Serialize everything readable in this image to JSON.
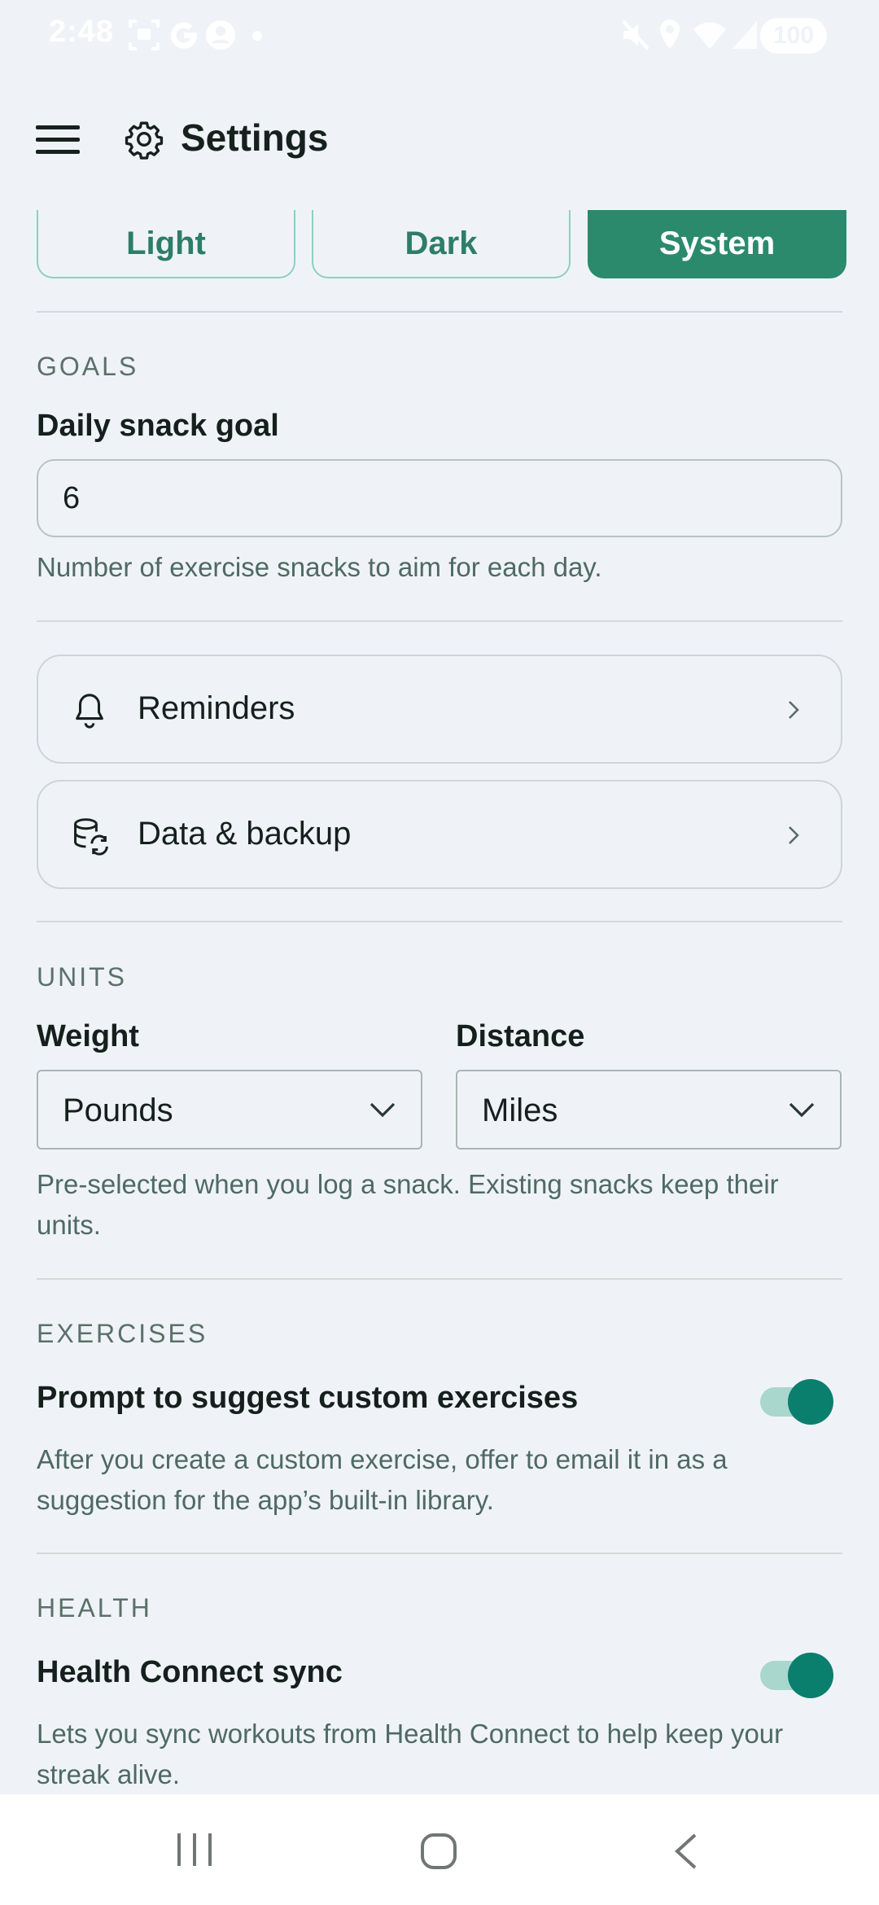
{
  "status_bar": {
    "time": "2:48",
    "battery": "100"
  },
  "app_bar": {
    "title": "Settings"
  },
  "theme": {
    "options": [
      "Light",
      "Dark",
      "System"
    ],
    "selected": "System"
  },
  "goals": {
    "section_label": "GOALS",
    "field_label": "Daily snack goal",
    "value": "6",
    "helper": "Number of exercise snacks to aim for each day."
  },
  "links": {
    "reminders": "Reminders",
    "data_backup": "Data & backup"
  },
  "units": {
    "section_label": "UNITS",
    "weight_label": "Weight",
    "weight_value": "Pounds",
    "distance_label": "Distance",
    "distance_value": "Miles",
    "helper": "Pre-selected when you log a snack. Existing snacks keep their units."
  },
  "exercises": {
    "section_label": "EXERCISES",
    "toggle_label": "Prompt to suggest custom exercises",
    "helper": "After you create a custom exercise, offer to email it in as a suggestion for the app’s built-in library.",
    "enabled": true
  },
  "health": {
    "section_label": "HEALTH",
    "toggle_label": "Health Connect sync",
    "helper": "Lets you sync workouts from Health Connect to help keep your streak alive.",
    "enabled": true
  },
  "colors": {
    "accent": "#2b8a6c",
    "toggle_on": "#0b7f6d",
    "background": "#eff3f8"
  }
}
